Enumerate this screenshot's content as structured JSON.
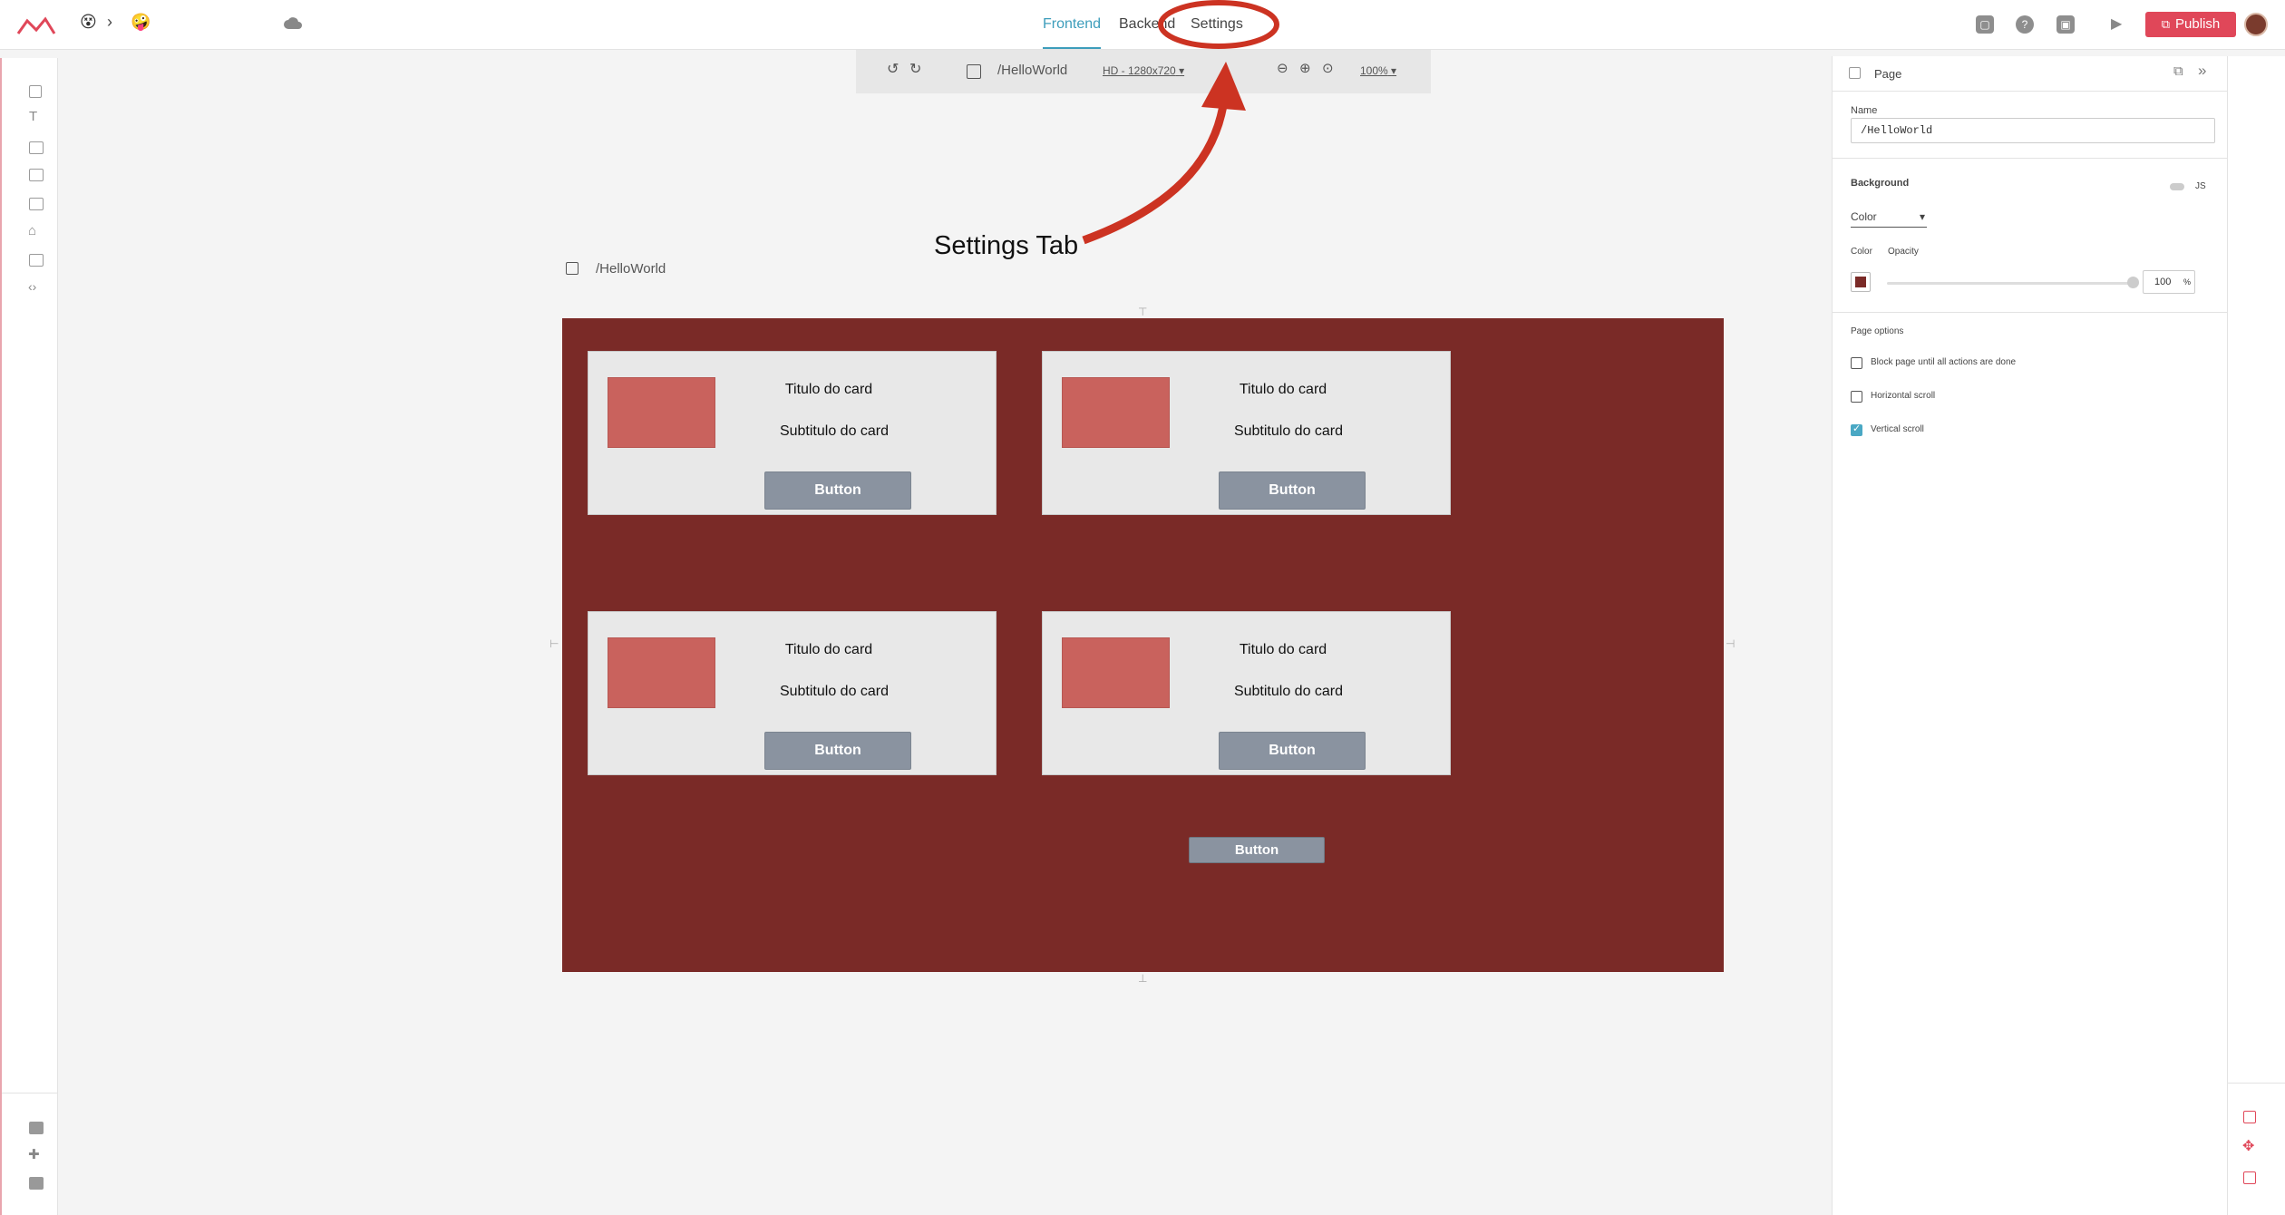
{
  "header": {
    "tabs": [
      {
        "label": "Frontend",
        "active": true
      },
      {
        "label": "Backend",
        "active": false
      },
      {
        "label": "Settings",
        "active": false
      }
    ],
    "publish_label": "Publish",
    "brand_color": "#e04759",
    "accent_color": "#3d9dbb"
  },
  "toolbar": {
    "page_path": "/HelloWorld",
    "resolution": "HD - 1280x720",
    "zoom": "100%"
  },
  "canvas": {
    "page_label": "/HelloWorld",
    "background_color": "#7a2a27",
    "cards": [
      {
        "title": "Titulo do card",
        "subtitle": "Subtitulo do card",
        "button": "Button"
      },
      {
        "title": "Titulo do card",
        "subtitle": "Subtitulo do card",
        "button": "Button"
      },
      {
        "title": "Titulo do card",
        "subtitle": "Subtitulo do card",
        "button": "Button"
      },
      {
        "title": "Titulo do card",
        "subtitle": "Subtitulo do card",
        "button": "Button"
      }
    ],
    "extra_button": "Button"
  },
  "panel": {
    "header": "Page",
    "name_label": "Name",
    "name_value": "/HelloWorld",
    "background_label": "Background",
    "js_label": "JS",
    "background_type": "Color",
    "color_label": "Color",
    "opacity_label": "Opacity",
    "opacity_value": "100",
    "opacity_unit": "%",
    "page_options_label": "Page options",
    "options": [
      {
        "label": "Block page until all actions are done",
        "checked": false
      },
      {
        "label": "Horizontal scroll",
        "checked": false
      },
      {
        "label": "Vertical scroll",
        "checked": true
      }
    ]
  },
  "annotation": {
    "text": "Settings Tab",
    "color": "#cc3322"
  }
}
